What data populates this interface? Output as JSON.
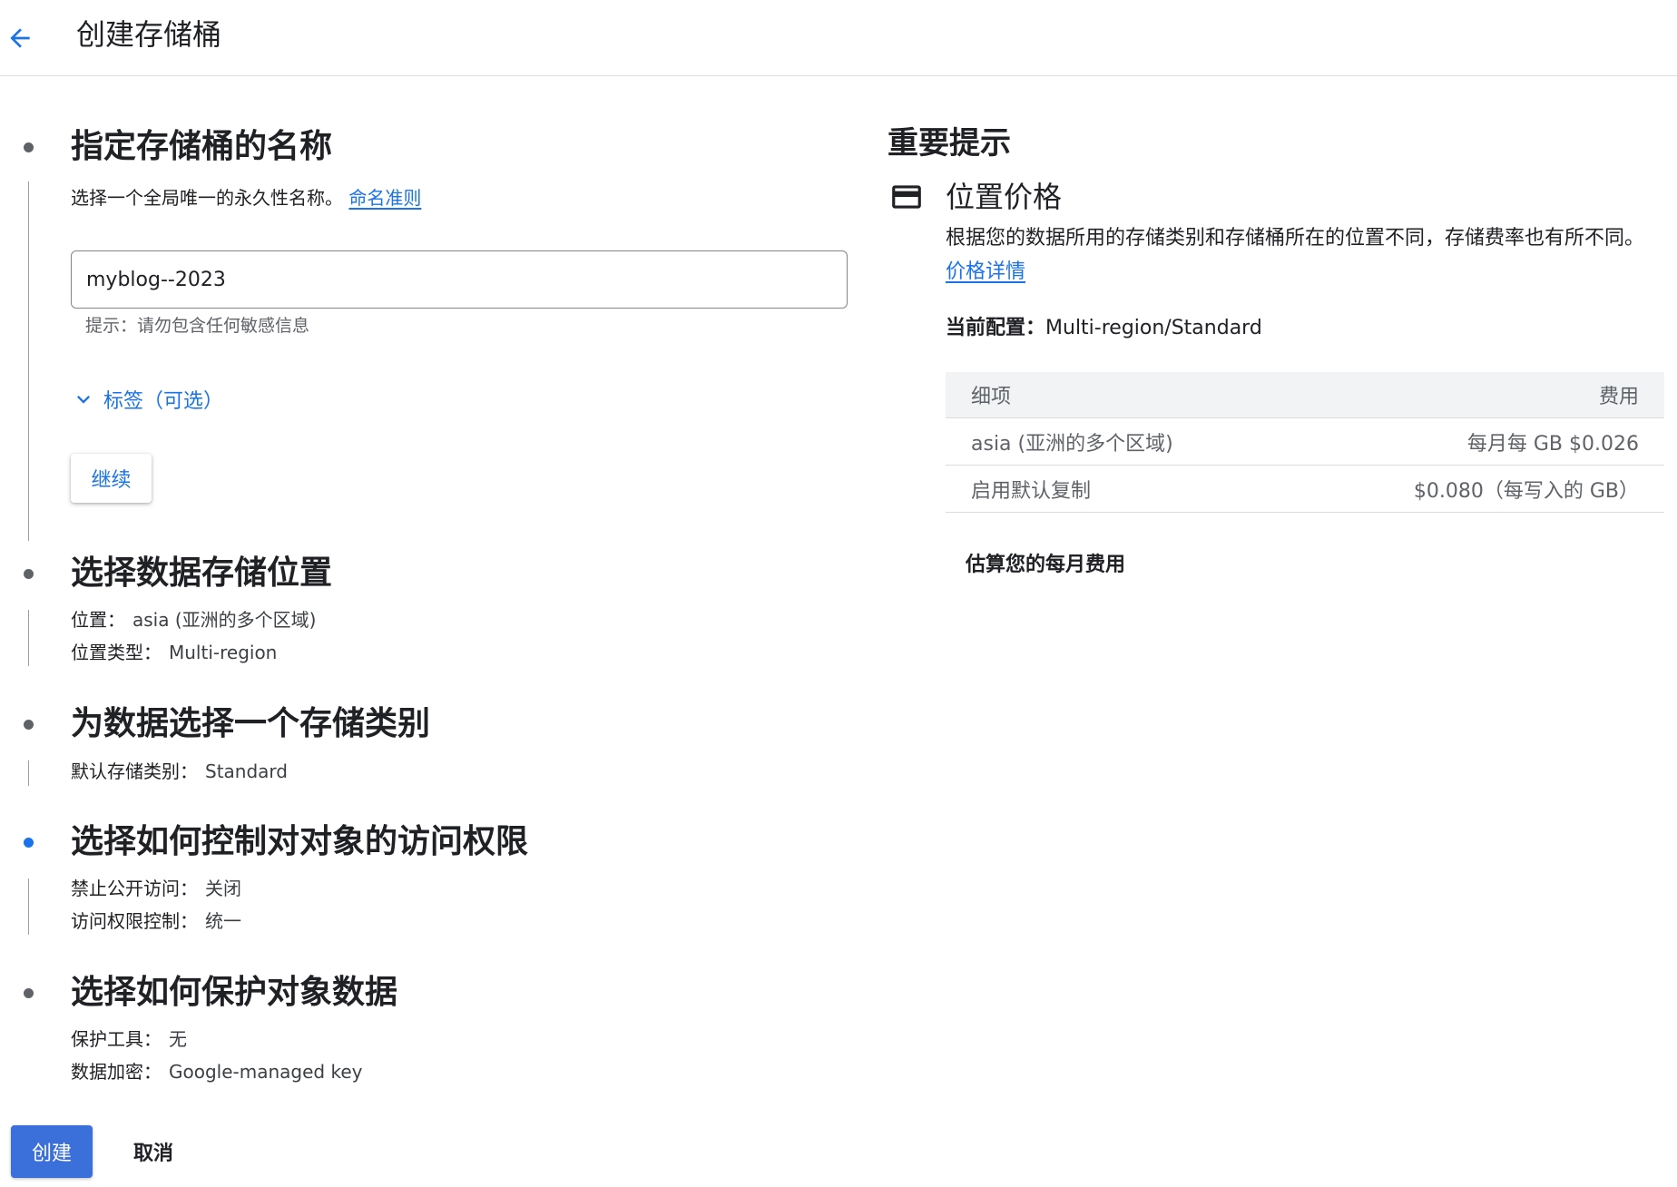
{
  "header": {
    "title": "创建存储桶"
  },
  "steps": [
    {
      "title": "指定存储桶的名称",
      "description": "选择一个全局唯一的永久性名称。",
      "link": "命名准则",
      "input_value": "myblog--2023",
      "hint": "提示：请勿包含任何敏感信息",
      "labels_toggle": "标签（可选）",
      "continue_label": "继续"
    },
    {
      "title": "选择数据存储位置",
      "rows": [
        {
          "label": "位置：",
          "value": "asia (亚洲的多个区域)"
        },
        {
          "label": "位置类型：",
          "value": "Multi-region"
        }
      ]
    },
    {
      "title": "为数据选择一个存储类别",
      "rows": [
        {
          "label": "默认存储类别：",
          "value": "Standard"
        }
      ]
    },
    {
      "title": "选择如何控制对对象的访问权限",
      "rows": [
        {
          "label": "禁止公开访问：",
          "value": "关闭"
        },
        {
          "label": "访问权限控制：",
          "value": "统一"
        }
      ]
    },
    {
      "title": "选择如何保护对象数据",
      "rows": [
        {
          "label": "保护工具：",
          "value": "无"
        },
        {
          "label": "数据加密：",
          "value": "Google-managed key"
        }
      ]
    }
  ],
  "footer": {
    "create_label": "创建",
    "cancel_label": "取消"
  },
  "tips": {
    "title": "重要提示",
    "price_title": "位置价格",
    "price_desc": "根据您的数据所用的存储类别和存储桶所在的位置不同，存储费率也有所不同。",
    "price_link": "价格详情",
    "current_config_label": "当前配置：",
    "current_config_value": "Multi-region/Standard",
    "table": {
      "headers": [
        "细项",
        "费用"
      ],
      "rows": [
        [
          "asia (亚洲的多个区域)",
          "每月每 GB $0.026"
        ],
        [
          "启用默认复制",
          "$0.080（每写入的 GB）"
        ]
      ]
    },
    "estimate_label": "估算您的每月费用"
  },
  "colors": {
    "accent": "#1a73e8",
    "primary_button": "#3b6fd9",
    "active_step_dot": "#1a73e8",
    "inactive_step_dot": "#5f6368"
  },
  "icons": {
    "back": "arrow-back-icon",
    "labels_toggle": "chevron-down-icon",
    "price": "credit-card-icon"
  }
}
